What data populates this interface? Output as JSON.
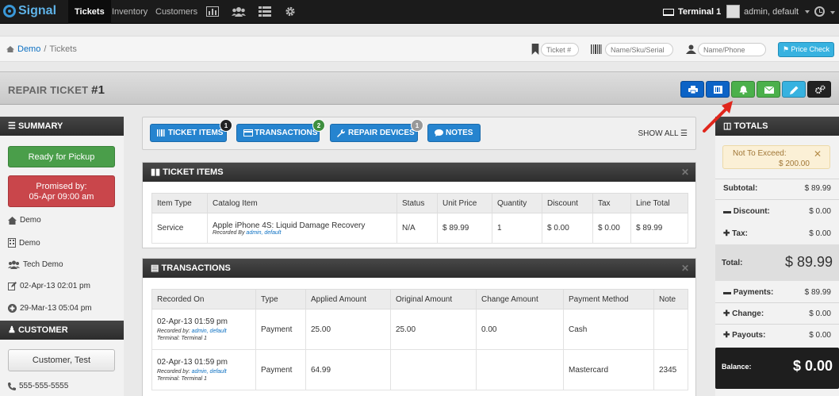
{
  "nav": {
    "brand": "Signal",
    "items": [
      "Tickets",
      "Inventory",
      "Customers"
    ],
    "terminal": "Terminal 1",
    "user": "admin, default"
  },
  "breadcrumb": {
    "home": "Demo",
    "current": "Tickets"
  },
  "search": {
    "ticket_placeholder": "Ticket #",
    "sku_placeholder": "Name/Sku/Serial",
    "name_placeholder": "Name/Phone",
    "price_check": "Price Check"
  },
  "title": {
    "prefix": "REPAIR TICKET",
    "number": "#1"
  },
  "toolbar": {
    "buttons": [
      {
        "name": "print",
        "color": "#0c63c6"
      },
      {
        "name": "barcode",
        "color": "#0c63c6"
      },
      {
        "name": "notify",
        "color": "#4bb04b"
      },
      {
        "name": "email",
        "color": "#4bb04b"
      },
      {
        "name": "edit",
        "color": "#37b2e0"
      },
      {
        "name": "settings",
        "color": "#222222"
      }
    ]
  },
  "summary": {
    "header": "SUMMARY",
    "status": "Ready for Pickup",
    "promised_label": "Promised by:",
    "promised_date": "05-Apr 09:00 am",
    "store": "Demo",
    "device_store": "Demo",
    "tech": "Tech Demo",
    "modified": "02-Apr-13 02:01 pm",
    "created": "29-Mar-13 05:04 pm"
  },
  "customer": {
    "header": "CUSTOMER",
    "name": "Customer, Test",
    "phone": "555-555-5555"
  },
  "tabs": [
    {
      "label": "TICKET ITEMS",
      "badge": "1",
      "badge_color": "#222222"
    },
    {
      "label": "TRANSACTIONS",
      "badge": "2",
      "badge_color": "#3f8f3f"
    },
    {
      "label": "REPAIR DEVICES",
      "badge": "1",
      "badge_color": "#999999"
    },
    {
      "label": "NOTES",
      "badge": "",
      "badge_color": ""
    }
  ],
  "show_all": "SHOW ALL",
  "ticket_items": {
    "header": "TICKET ITEMS",
    "columns": [
      "Item Type",
      "Catalog Item",
      "Status",
      "Unit Price",
      "Quantity",
      "Discount",
      "Tax",
      "Line Total"
    ],
    "rows": [
      {
        "type": "Service",
        "item": "Apple iPhone 4S: Liquid Damage Recovery",
        "recorded_prefix": "Recorded By",
        "recorded_user": "admin, default",
        "status": "N/A",
        "unit_price": "$ 89.99",
        "qty": "1",
        "discount": "$ 0.00",
        "tax": "$ 0.00",
        "total": "$ 89.99"
      }
    ]
  },
  "transactions": {
    "header": "TRANSACTIONS",
    "columns": [
      "Recorded On",
      "Type",
      "Applied Amount",
      "Original Amount",
      "Change Amount",
      "Payment Method",
      "Note"
    ],
    "rows": [
      {
        "date": "02-Apr-13 01:59 pm",
        "by_prefix": "Recorded by:",
        "by_user": "admin, default",
        "terminal": "Terminal: Terminal 1",
        "type": "Payment",
        "applied": "25.00",
        "original": "25.00",
        "change": "0.00",
        "method": "Cash",
        "note": ""
      },
      {
        "date": "02-Apr-13 01:59 pm",
        "by_prefix": "Recorded by:",
        "by_user": "admin, default",
        "terminal": "Terminal: Terminal 1",
        "type": "Payment",
        "applied": "64.99",
        "original": "",
        "change": "",
        "method": "Mastercard",
        "note": "2345"
      }
    ]
  },
  "totals": {
    "header": "TOTALS",
    "nte_label": "Not To Exceed:",
    "nte_value": "$ 200.00",
    "subtotal_label": "Subtotal:",
    "subtotal": "$ 89.99",
    "discount_label": "Discount:",
    "discount": "$ 0.00",
    "tax_label": "Tax:",
    "tax": "$ 0.00",
    "total_label": "Total:",
    "total": "$ 89.99",
    "payments_label": "Payments:",
    "payments": "$ 89.99",
    "change_label": "Change:",
    "change": "$ 0.00",
    "payouts_label": "Payouts:",
    "payouts": "$ 0.00",
    "balance_label": "Balance:",
    "balance": "$ 0.00"
  }
}
